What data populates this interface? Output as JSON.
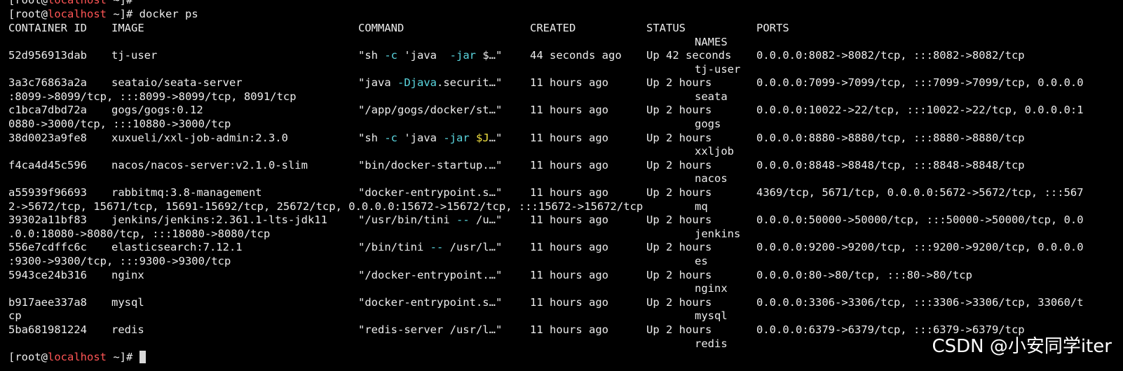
{
  "terminal": {
    "prev_prompt": {
      "open": "[root@",
      "host": "localhost",
      "rest": " ~]#"
    },
    "cmd_prompt": {
      "open": "[root@",
      "host": "localhost",
      "rest": " ~]# ",
      "command": "docker ps"
    },
    "header": {
      "container_id": "CONTAINER ID",
      "image": "IMAGE",
      "command": "COMMAND",
      "created": "CREATED",
      "status": "STATUS",
      "ports": "PORTS",
      "names": "NAMES"
    },
    "rows": [
      {
        "id": "52d956913dab",
        "image": "tj-user",
        "command": {
          "a": "\"sh ",
          "b": "-c",
          "c": " 'java  ",
          "d": "-jar",
          "e": " $…\""
        },
        "created": "44 seconds ago",
        "status": "Up 42 seconds",
        "ports": "0.0.0.0:8082->8082/tcp, :::8082->8082/tcp",
        "ports_cont": "",
        "name": "tj-user"
      },
      {
        "id": "3a3c76863a2a",
        "image": "seataio/seata-server",
        "command": {
          "a": "\"java ",
          "b": "-Djava",
          "c": ".securit…\""
        },
        "created": "11 hours ago",
        "status": "Up 2 hours",
        "ports": "0.0.0.0:7099->7099/tcp, :::7099->7099/tcp, 0.0.0.0",
        "ports_cont": ":8099->8099/tcp, :::8099->8099/tcp, 8091/tcp",
        "name": "seata"
      },
      {
        "id": "c1bca7dbd72a",
        "image": "gogs/gogs:0.12",
        "command": {
          "a": "\"/app/gogs/docker/st…\""
        },
        "created": "11 hours ago",
        "status": "Up 2 hours",
        "ports": "0.0.0.0:10022->22/tcp, :::10022->22/tcp, 0.0.0.0:1",
        "ports_cont": "0880->3000/tcp, :::10880->3000/tcp",
        "name": "gogs"
      },
      {
        "id": "38d0023a9fe8",
        "image": "xuxueli/xxl-job-admin:2.3.0",
        "command": {
          "a": "\"sh ",
          "b": "-c",
          "c": " 'java ",
          "d": "-jar",
          "e": " ",
          "f": "$J",
          "g": "…\""
        },
        "created": "11 hours ago",
        "status": "Up 2 hours",
        "ports": "0.0.0.0:8880->8880/tcp, :::8880->8880/tcp",
        "ports_cont": "",
        "name": "xxljob"
      },
      {
        "id": "f4ca4d45c596",
        "image": "nacos/nacos-server:v2.1.0-slim",
        "command": {
          "a": "\"bin/docker-startup.…\""
        },
        "created": "11 hours ago",
        "status": "Up 2 hours",
        "ports": "0.0.0.0:8848->8848/tcp, :::8848->8848/tcp",
        "ports_cont": "",
        "name": "nacos"
      },
      {
        "id": "a55939f96693",
        "image": "rabbitmq:3.8-management",
        "command": {
          "a": "\"docker-entrypoint.s…\""
        },
        "created": "11 hours ago",
        "status": "Up 2 hours",
        "ports": "4369/tcp, 5671/tcp, 0.0.0.0:5672->5672/tcp, :::567",
        "ports_cont": "2->5672/tcp, 15671/tcp, 15691-15692/tcp, 25672/tcp, 0.0.0.0:15672->15672/tcp, :::15672->15672/tcp",
        "name": "mq"
      },
      {
        "id": "39302a11bf83",
        "image": "jenkins/jenkins:2.361.1-lts-jdk11",
        "command": {
          "a": "\"/usr/bin/tini ",
          "b": "--",
          "c": " /u…\""
        },
        "created": "11 hours ago",
        "status": "Up 2 hours",
        "ports": "0.0.0.0:50000->50000/tcp, :::50000->50000/tcp, 0.0",
        "ports_cont": ".0.0:18080->8080/tcp, :::18080->8080/tcp",
        "name": "jenkins"
      },
      {
        "id": "556e7cdffc6c",
        "image": "elasticsearch:7.12.1",
        "command": {
          "a": "\"/bin/tini ",
          "b": "--",
          "c": " /usr/l…\""
        },
        "created": "11 hours ago",
        "status": "Up 2 hours",
        "ports": "0.0.0.0:9200->9200/tcp, :::9200->9200/tcp, 0.0.0.0",
        "ports_cont": ":9300->9300/tcp, :::9300->9300/tcp",
        "name": "es"
      },
      {
        "id": "5943ce24b316",
        "image": "nginx",
        "command": {
          "a": "\"/docker-entrypoint.…\""
        },
        "created": "11 hours ago",
        "status": "Up 2 hours",
        "ports": "0.0.0.0:80->80/tcp, :::80->80/tcp",
        "ports_cont": "",
        "name": "nginx"
      },
      {
        "id": "b917aee337a8",
        "image": "mysql",
        "command": {
          "a": "\"docker-entrypoint.s…\""
        },
        "created": "11 hours ago",
        "status": "Up 2 hours",
        "ports": "0.0.0.0:3306->3306/tcp, :::3306->3306/tcp, 33060/t",
        "ports_cont": "cp",
        "name": "mysql"
      },
      {
        "id": "5ba681981224",
        "image": "redis",
        "command": {
          "a": "\"redis-server /usr/l…\""
        },
        "created": "11 hours ago",
        "status": "Up 2 hours",
        "ports": "0.0.0.0:6379->6379/tcp, :::6379->6379/tcp",
        "ports_cont": "",
        "name": "redis"
      }
    ],
    "final_prompt": {
      "open": "[root@",
      "host": "localhost",
      "rest": " ~]# "
    }
  },
  "watermark": "CSDN @小安同学iter",
  "colors": {
    "background": "#000000",
    "text": "#ececec",
    "host": "#ff5555",
    "flag": "#5bd7e0",
    "variable": "#f0e040"
  }
}
